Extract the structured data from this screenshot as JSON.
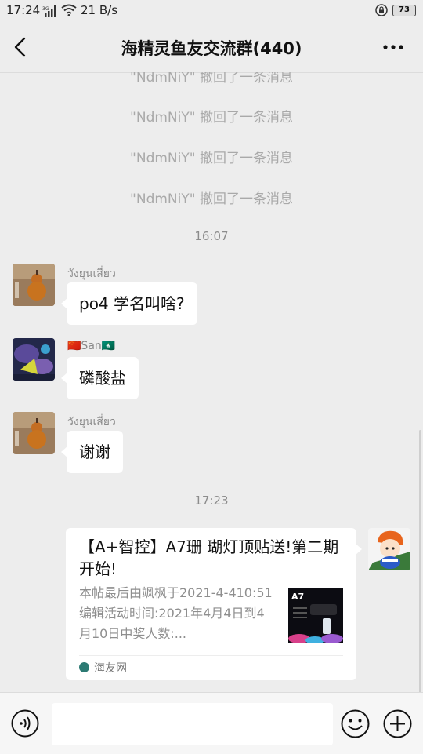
{
  "status_bar": {
    "time": "17:24",
    "network": "21 B/s",
    "battery": "73"
  },
  "header": {
    "title": "海精灵鱼友交流群(440)"
  },
  "chat": {
    "system_messages": [
      "\"NdmNiY\" 撤回了一条消息",
      "\"NdmNiY\" 撤回了一条消息",
      "\"NdmNiY\" 撤回了一条消息",
      "\"NdmNiY\" 撤回了一条消息"
    ],
    "timestamp_1": "16:07",
    "messages": [
      {
        "sender": "วังยุนเสี่ยว",
        "text": "po4 学名叫啥?"
      },
      {
        "sender": "🇨🇳San🇲🇴",
        "text": "磷酸盐"
      },
      {
        "sender": "วังยุนเสี่ยว",
        "text": "谢谢"
      }
    ],
    "timestamp_2": "17:23",
    "link_card": {
      "title": "【A+智控】A7珊 瑚灯顶贴送!第二期开始!",
      "description": "本帖最后由飒枫于2021-4-410:51编辑活动时间:2021年4月4日到4月10日中奖人数:...",
      "thumbnail_label": "A7",
      "source": "海友网"
    }
  },
  "icons": {
    "back": "chevron-left-icon",
    "more": "more-dots-icon",
    "voice": "voice-icon",
    "emoji": "emoji-icon",
    "plus": "plus-icon"
  },
  "colors": {
    "background": "#ededed",
    "bubble": "#ffffff",
    "system_text": "#a9a9a9"
  }
}
